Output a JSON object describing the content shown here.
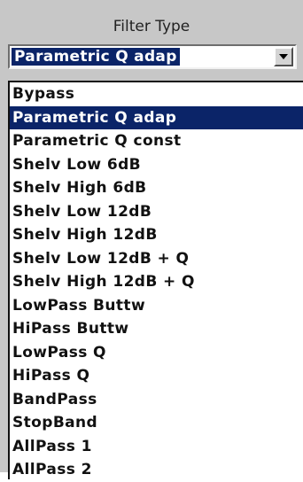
{
  "filter_type": {
    "label": "Filter Type",
    "selected_value": "Parametric Q adap",
    "dropdown_icon": "chevron-down-icon",
    "options": [
      "Bypass",
      "Parametric Q adap",
      "Parametric Q const",
      "Shelv Low 6dB",
      "Shelv High 6dB",
      "Shelv Low 12dB",
      "Shelv High 12dB",
      "Shelv Low 12dB + Q",
      "Shelv High 12dB + Q",
      "LowPass Buttw",
      "HiPass Buttw",
      "LowPass Q",
      "HiPass Q",
      "BandPass",
      "StopBand",
      "AllPass 1",
      "AllPass 2"
    ],
    "selected_index": 1
  },
  "colors": {
    "selection": "#0b2468",
    "panel": "#c7c7c7"
  }
}
